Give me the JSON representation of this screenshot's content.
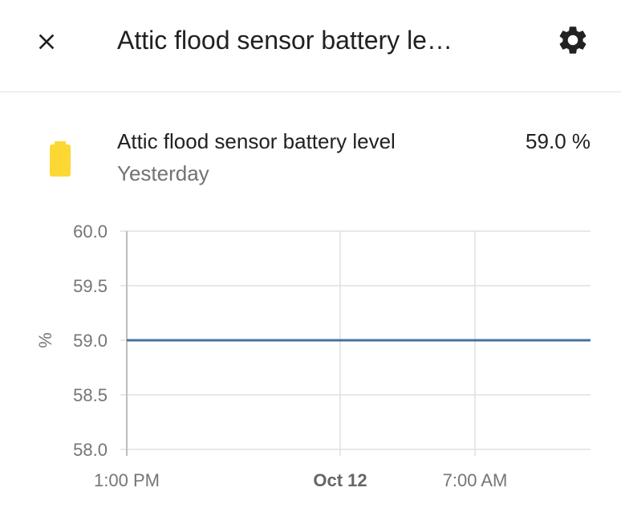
{
  "header": {
    "title": "Attic flood sensor battery le…",
    "close_icon": "close-icon",
    "settings_icon": "gear-icon"
  },
  "entity": {
    "name": "Attic flood sensor battery level",
    "time": "Yesterday",
    "state": "59.0 %",
    "icon": "battery-icon",
    "icon_color": "#fdd835"
  },
  "chart_data": {
    "type": "line",
    "title": "",
    "ylabel": "%",
    "xlabel": "",
    "ylim": [
      58.0,
      60.0
    ],
    "y_ticks": [
      "60.0",
      "59.5",
      "59.0",
      "58.5",
      "58.0"
    ],
    "x_ticks": [
      {
        "label": "1:00 PM",
        "bold": false
      },
      {
        "label": "Oct 12",
        "bold": true
      },
      {
        "label": "7:00 AM",
        "bold": false
      }
    ],
    "grid": true,
    "series": [
      {
        "color": "#44739e",
        "x": [
          "1:00 PM",
          "end"
        ],
        "values": [
          59.0,
          59.0
        ]
      }
    ]
  }
}
